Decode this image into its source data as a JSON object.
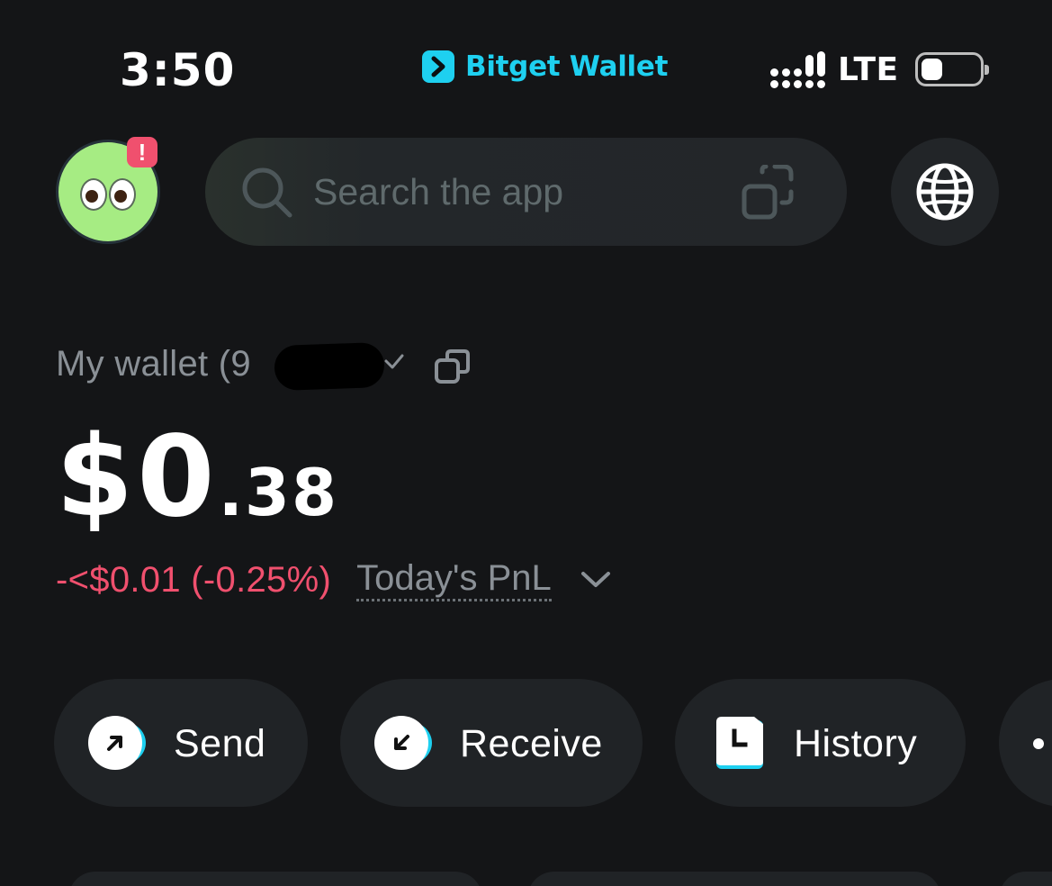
{
  "status_bar": {
    "time": "3:50",
    "brand_name": "Bitget Wallet",
    "network": "LTE",
    "brand_color": "#1ed0f0"
  },
  "header": {
    "search_placeholder": "Search the app",
    "notification_badge": "!"
  },
  "wallet": {
    "name": "My wallet (9",
    "balance_main": "$0",
    "balance_decimal": ".38",
    "pnl_value": "-<$0.01 (-0.25%)",
    "pnl_label": "Today's PnL",
    "pnl_color": "#f0506e"
  },
  "actions": [
    {
      "label": "Send",
      "icon": "arrow-up-right-icon"
    },
    {
      "label": "Receive",
      "icon": "arrow-down-left-icon"
    },
    {
      "label": "History",
      "icon": "history-clock-icon"
    }
  ],
  "more_actions_icon": "more-icon"
}
